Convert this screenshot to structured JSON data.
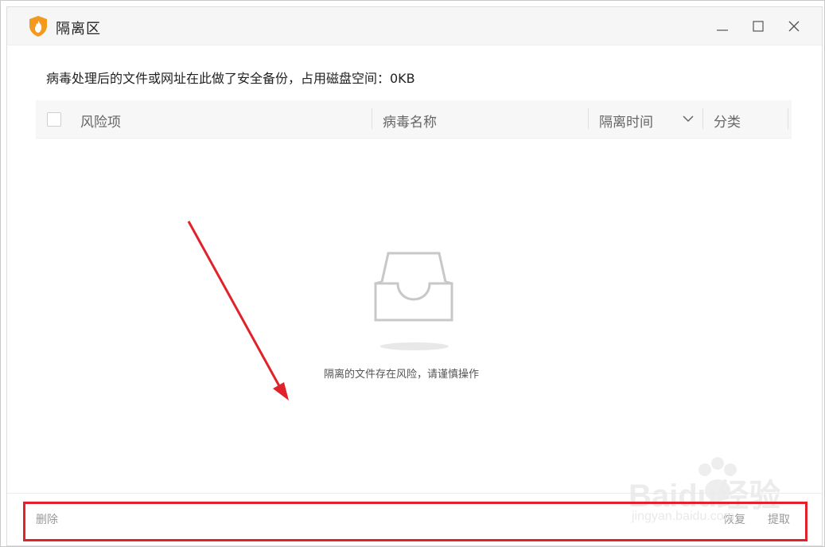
{
  "window": {
    "title": "隔离区",
    "controls": {
      "minimize": "—",
      "maximize": "☐",
      "close": "✕"
    }
  },
  "info_text": "病毒处理后的文件或网址在此做了安全备份，占用磁盘空间：0KB",
  "table": {
    "columns": [
      "风险项",
      "病毒名称",
      "隔离时间",
      "分类"
    ],
    "rows": []
  },
  "empty_state": {
    "message": "隔离的文件存在风险，请谨慎操作",
    "icon": "empty-tray-icon"
  },
  "footer": {
    "delete_label": "删除",
    "restore_label": "恢复",
    "extract_label": "提取"
  },
  "watermark": {
    "brand": "Baidu经验",
    "url": "jingyan.baidu.com"
  },
  "colors": {
    "titlebar_bg": "#f6f6f6",
    "header_bg": "#f7f7f7",
    "annotation_red": "#e0222b",
    "app_icon_orange": "#f39a1e"
  }
}
